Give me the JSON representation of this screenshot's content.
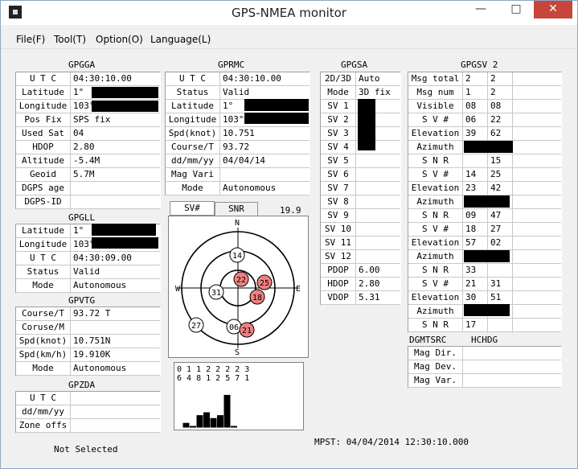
{
  "window": {
    "title": "GPS-NMEA monitor",
    "minimize": "—",
    "maximize": "□",
    "close": "✕"
  },
  "menu": [
    "File(F)",
    "Tool(T)",
    "Option(O)",
    "Language(L)"
  ],
  "gpgga": {
    "title": "GPGGA",
    "rows": [
      {
        "label": "U T C",
        "value": "04:30:10.00"
      },
      {
        "label": "Latitude",
        "value": "1°"
      },
      {
        "label": "Longitude",
        "value": "103°"
      },
      {
        "label": "Pos Fix",
        "value": "SPS fix"
      },
      {
        "label": "Used Sat",
        "value": "04"
      },
      {
        "label": "HDOP",
        "value": "2.80"
      },
      {
        "label": "Altitude",
        "value": "-5.4M"
      },
      {
        "label": "Geoid",
        "value": "5.7M"
      },
      {
        "label": "DGPS age",
        "value": ""
      },
      {
        "label": "DGPS-ID",
        "value": ""
      }
    ]
  },
  "gpgll": {
    "title": "GPGLL",
    "rows": [
      {
        "label": "Latitude",
        "value": "1°"
      },
      {
        "label": "Longitude",
        "value": "103°"
      },
      {
        "label": "U T C",
        "value": "04:30:09.00"
      },
      {
        "label": "Status",
        "value": "Valid"
      },
      {
        "label": "Mode",
        "value": "Autonomous"
      }
    ]
  },
  "gpvtg": {
    "title": "GPVTG",
    "rows": [
      {
        "label": "Course/T",
        "value": "93.72 T"
      },
      {
        "label": "Coruse/M",
        "value": ""
      },
      {
        "label": "Spd(knot)",
        "value": "10.751N"
      },
      {
        "label": "Spd(km/h)",
        "value": "19.910K"
      },
      {
        "label": "Mode",
        "value": "Autonomous"
      }
    ]
  },
  "gpzda": {
    "title": "GPZDA",
    "rows": [
      {
        "label": "U T C",
        "value": ""
      },
      {
        "label": "dd/mm/yy",
        "value": ""
      },
      {
        "label": "Zone offs",
        "value": ""
      }
    ]
  },
  "gprmc": {
    "title": "GPRMC",
    "rows": [
      {
        "label": "U T C",
        "value": "04:30:10.00"
      },
      {
        "label": "Status",
        "value": "Valid"
      },
      {
        "label": "Latitude",
        "value": "1°"
      },
      {
        "label": "Longitude",
        "value": "103°"
      },
      {
        "label": "Spd(knot)",
        "value": "10.751"
      },
      {
        "label": "Course/T",
        "value": "93.72"
      },
      {
        "label": "dd/mm/yy",
        "value": "04/04/14"
      },
      {
        "label": "Mag Vari",
        "value": ""
      },
      {
        "label": "Mode",
        "value": "Autonomous"
      }
    ]
  },
  "gpgsa": {
    "title": "GPGSA",
    "rows": [
      {
        "label": "2D/3D",
        "value": "Auto"
      },
      {
        "label": "Mode",
        "value": "3D fix"
      },
      {
        "label": "SV  1",
        "value": ""
      },
      {
        "label": "SV  2",
        "value": ""
      },
      {
        "label": "SV  3",
        "value": ""
      },
      {
        "label": "SV  4",
        "value": ""
      },
      {
        "label": "SV  5",
        "value": ""
      },
      {
        "label": "SV  6",
        "value": ""
      },
      {
        "label": "SV  7",
        "value": ""
      },
      {
        "label": "SV  8",
        "value": ""
      },
      {
        "label": "SV  9",
        "value": ""
      },
      {
        "label": "SV 10",
        "value": ""
      },
      {
        "label": "SV 11",
        "value": ""
      },
      {
        "label": "SV 12",
        "value": ""
      },
      {
        "label": "PDOP",
        "value": "6.00"
      },
      {
        "label": "HDOP",
        "value": "2.80"
      },
      {
        "label": "VDOP",
        "value": "5.31"
      }
    ]
  },
  "gpgsv": {
    "title": "GPGSV 2",
    "rows": [
      {
        "label": "Msg total",
        "v1": "2",
        "v2": "2"
      },
      {
        "label": "Msg num",
        "v1": "1",
        "v2": "2"
      },
      {
        "label": "Visible",
        "v1": "08",
        "v2": "08"
      },
      {
        "label": "S V #",
        "v1": "06",
        "v2": "22"
      },
      {
        "label": "Elevation",
        "v1": "39",
        "v2": "62"
      },
      {
        "label": "Azimuth",
        "v1": "",
        "v2": ""
      },
      {
        "label": "S N R",
        "v1": "",
        "v2": "15"
      },
      {
        "label": "S V #",
        "v1": "14",
        "v2": "25"
      },
      {
        "label": "Elevation",
        "v1": "23",
        "v2": "42"
      },
      {
        "label": "Azimuth",
        "v1": "",
        "v2": ""
      },
      {
        "label": "S N R",
        "v1": "09",
        "v2": "47"
      },
      {
        "label": "S V #",
        "v1": "18",
        "v2": "27"
      },
      {
        "label": "Elevation",
        "v1": "57",
        "v2": "02"
      },
      {
        "label": "Azimuth",
        "v1": "",
        "v2": ""
      },
      {
        "label": "S N R",
        "v1": "33",
        "v2": ""
      },
      {
        "label": "S V #",
        "v1": "21",
        "v2": "31"
      },
      {
        "label": "Elevation",
        "v1": "30",
        "v2": "51"
      },
      {
        "label": "Azimuth",
        "v1": "",
        "v2": ""
      },
      {
        "label": "S N R",
        "v1": "17",
        "v2": ""
      }
    ]
  },
  "dgmtsrc": {
    "title": "DGMTSRC",
    "title2": "HCHDG",
    "rows": [
      {
        "label": "Mag Dir.",
        "value": ""
      },
      {
        "label": "Mag Dev.",
        "value": ""
      },
      {
        "label": "Mag Var.",
        "value": ""
      }
    ]
  },
  "skyview": {
    "tabs": [
      "SV#",
      "SNR"
    ],
    "speed": "19.9",
    "compass": {
      "n": "N",
      "s": "S",
      "e": "E",
      "w": "W"
    },
    "satellites": [
      {
        "sv": "14",
        "elevation": 23,
        "used": false
      },
      {
        "sv": "22",
        "elevation": 62,
        "used": true
      },
      {
        "sv": "25",
        "elevation": 42,
        "used": true
      },
      {
        "sv": "18",
        "elevation": 57,
        "used": true
      },
      {
        "sv": "31",
        "elevation": 51,
        "used": false
      },
      {
        "sv": "27",
        "elevation": 2,
        "used": false
      },
      {
        "sv": "06",
        "elevation": 39,
        "used": false
      },
      {
        "sv": "21",
        "elevation": 30,
        "used": true
      }
    ],
    "colors": {
      "used": "#f08080",
      "unused": "#ffffff"
    }
  },
  "snr_bars": {
    "row1": "0 1 1 2 2 2 2 3",
    "row2": "6 4 8 1 2 5 7 1",
    "values": [
      4,
      0,
      12,
      15,
      9,
      12,
      33,
      0
    ]
  },
  "status": {
    "left": "Not Selected",
    "right": "MPST: 04/04/2014 12:30:10.000"
  }
}
